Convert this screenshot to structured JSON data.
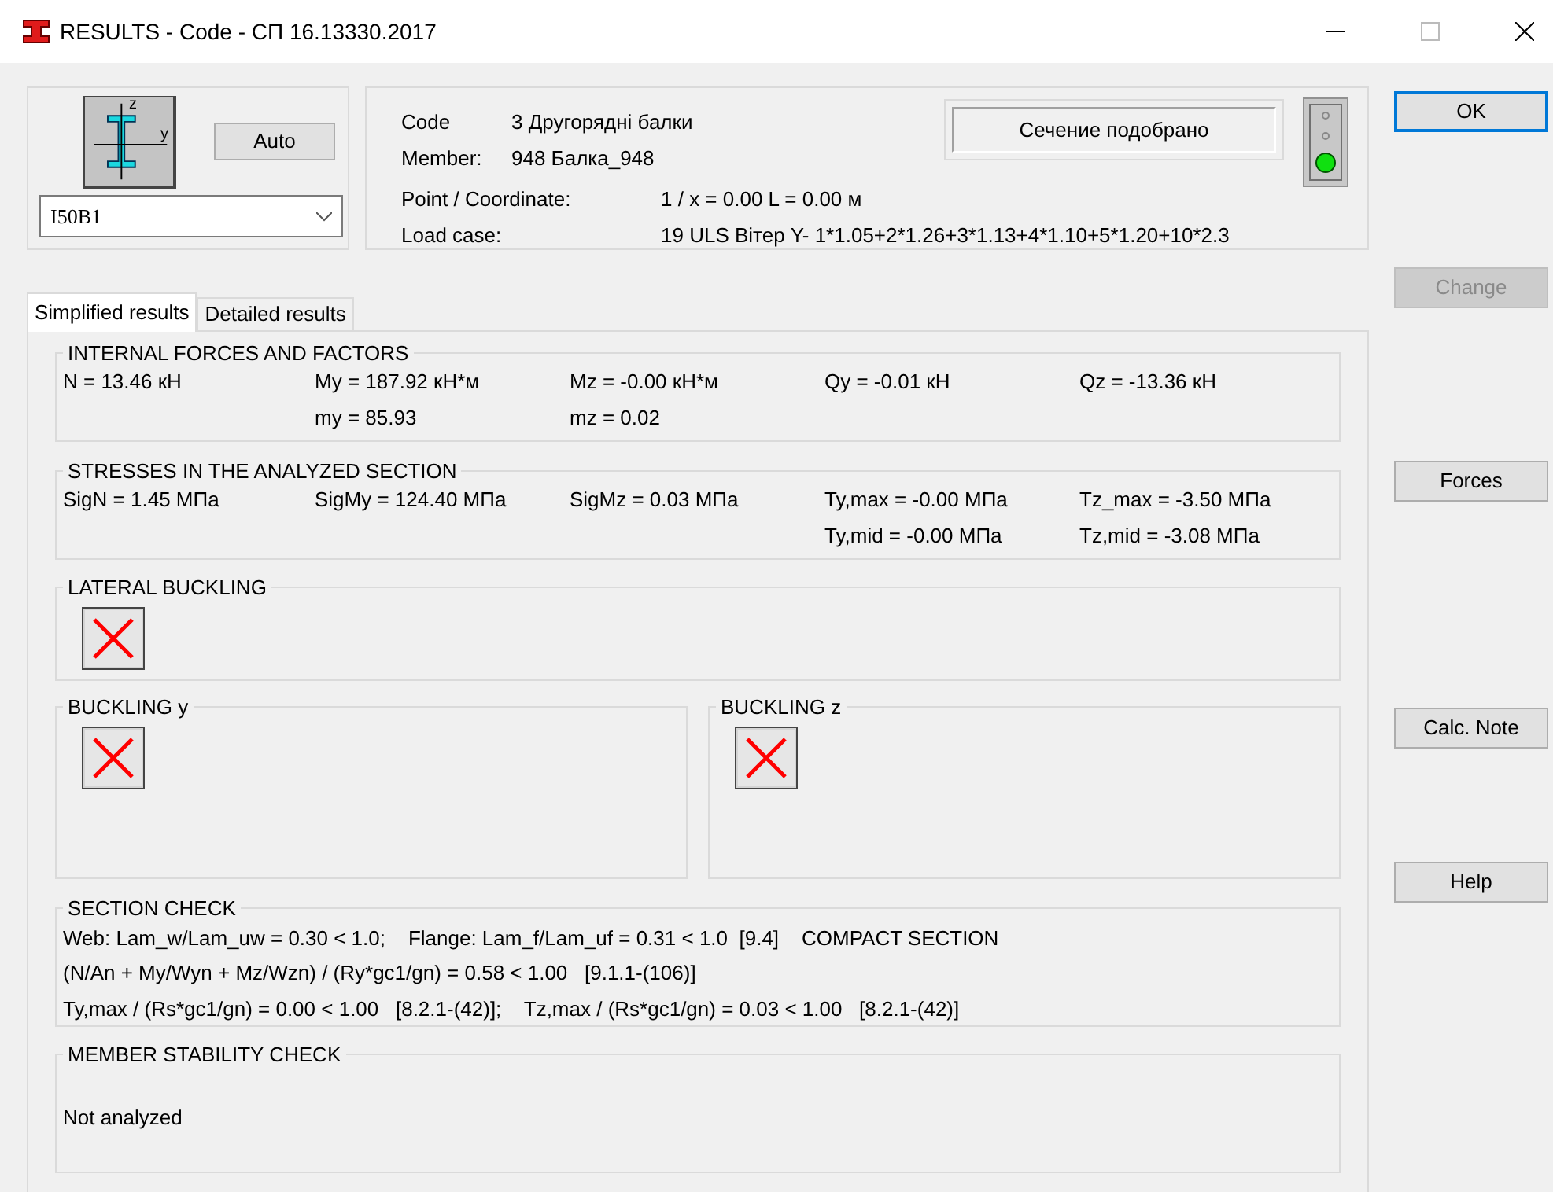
{
  "window": {
    "title": "RESULTS - Code - СП 16.13330.2017"
  },
  "section": {
    "axis_labels": [
      "z",
      "y"
    ],
    "auto_button": "Auto",
    "profile": "I50B1"
  },
  "info": {
    "rows": [
      {
        "label": "Code",
        "value": "3  Другорядні балки"
      },
      {
        "label": "Member:",
        "value": "948  Балка_948"
      },
      {
        "label": "Point / Coordinate:",
        "value": "1 / x = 0.00 L = 0.00 м"
      },
      {
        "label": "Load case:",
        "value": "19 ULS Вітер Y-  1*1.05+2*1.26+3*1.13+4*1.10+5*1.20+10*2.3"
      }
    ],
    "status_text": "Сечение подобрано",
    "lights": [
      {
        "on": false
      },
      {
        "on": false
      },
      {
        "on": true
      }
    ]
  },
  "tabs": [
    {
      "label": "Simplified results",
      "selected": true
    },
    {
      "label": "Detailed results",
      "selected": false
    }
  ],
  "groups": [
    {
      "kind": "columns",
      "title": "INTERNAL FORCES AND FACTORS",
      "columns": [
        [
          "N = 13.46 кН"
        ],
        [
          "My = 187.92 кН*м",
          "my = 85.93"
        ],
        [
          "Mz = -0.00 кН*м",
          "mz = 0.02"
        ],
        [
          "Qy = -0.01 кН"
        ],
        [
          "Qz = -13.36 кН"
        ]
      ]
    },
    {
      "kind": "columns",
      "title": "STRESSES IN THE ANALYZED SECTION",
      "columns": [
        [
          "SigN = 1.45 МПа"
        ],
        [
          "SigMy = 124.40 МПа"
        ],
        [
          "SigMz = 0.03 МПа"
        ],
        [
          "Ty,max = -0.00 МПа",
          "Ty,mid = -0.00 МПа"
        ],
        [
          "Tz_max = -3.50 МПа",
          "Tz,mid = -3.08 МПа"
        ]
      ]
    },
    {
      "kind": "status",
      "title": "LATERAL BUCKLING",
      "passed": false
    },
    {
      "kind": "pair",
      "items": [
        {
          "title": "BUCKLING y",
          "passed": false
        },
        {
          "title": "BUCKLING z",
          "passed": false
        }
      ]
    },
    {
      "kind": "lines",
      "title": "SECTION CHECK",
      "lines": [
        "Web: Lam_w/Lam_uw = 0.30 < 1.0;    Flange: Lam_f/Lam_uf = 0.31 < 1.0  [9.4]    COMPACT SECTION",
        "(N/An + My/Wyn + Mz/Wzn) / (Ry*gc1/gn) = 0.58 < 1.00   [9.1.1-(106)]",
        "Ty,max / (Rs*gc1/gn) = 0.00 < 1.00   [8.2.1-(42)];    Tz,max / (Rs*gc1/gn) = 0.03 < 1.00   [8.2.1-(42)]"
      ]
    },
    {
      "kind": "note",
      "title": "MEMBER STABILITY CHECK",
      "lines": [
        "Not analyzed"
      ]
    }
  ],
  "buttons": [
    {
      "label": "OK",
      "default": true,
      "disabled": false
    },
    {
      "label": "Change",
      "default": false,
      "disabled": true
    },
    {
      "label": "Forces",
      "default": false,
      "disabled": false
    },
    {
      "label": "Calc. Note",
      "default": false,
      "disabled": false
    },
    {
      "label": "Help",
      "default": false,
      "disabled": false
    }
  ]
}
